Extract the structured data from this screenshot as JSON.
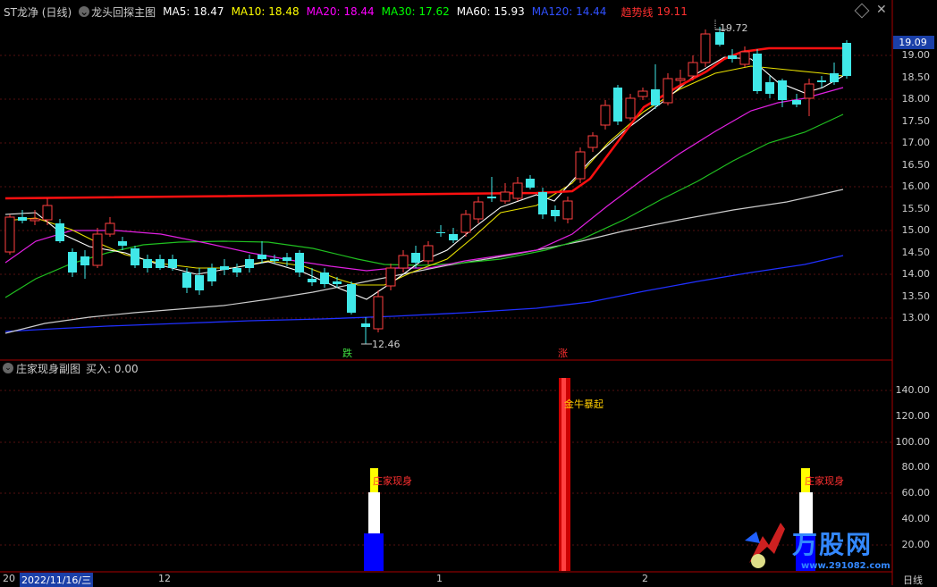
{
  "main": {
    "title": "ST龙净 (日线)",
    "indicator_name": "龙头回探主图",
    "ma": [
      {
        "label": "MA5:",
        "value": "18.47",
        "color": "#ffffff"
      },
      {
        "label": "MA10:",
        "value": "18.48",
        "color": "#ffff00"
      },
      {
        "label": "MA20:",
        "value": "18.44",
        "color": "#ff00ff"
      },
      {
        "label": "MA30:",
        "value": "17.62",
        "color": "#00ff00"
      },
      {
        "label": "MA60:",
        "value": "15.93",
        "color": "#ffffff"
      },
      {
        "label": "MA120:",
        "value": "14.44",
        "color": "#0000ff"
      }
    ],
    "trend_label": "趋势线",
    "trend_value": "19.11",
    "high_label": "19.72",
    "low_label": "12.46",
    "current_price": "19.09",
    "y_ticks": [
      "19.00",
      "18.50",
      "18.00",
      "17.50",
      "17.00",
      "16.50",
      "16.00",
      "15.50",
      "15.00",
      "14.50",
      "14.00",
      "13.50",
      "13.00"
    ],
    "down_marker": "跌",
    "up_marker": "涨"
  },
  "sub": {
    "title": "庄家现身副图",
    "buy_label": "买入: 0.00",
    "y_ticks": [
      "140.00",
      "120.00",
      "100.00",
      "80.00",
      "60.00",
      "40.00",
      "20.00"
    ],
    "label_zhuang1": "庄家现身",
    "label_zhuang2": "庄家现身",
    "label_jinniu": "金牛暴起"
  },
  "bottom": {
    "date_box": "2022/11/16/三",
    "year_prefix": "20",
    "month_12": "12",
    "month_1": "1",
    "month_2": "2",
    "period": "日线"
  },
  "watermark": {
    "brand": "万股网",
    "url": "www.291082.com"
  }
}
